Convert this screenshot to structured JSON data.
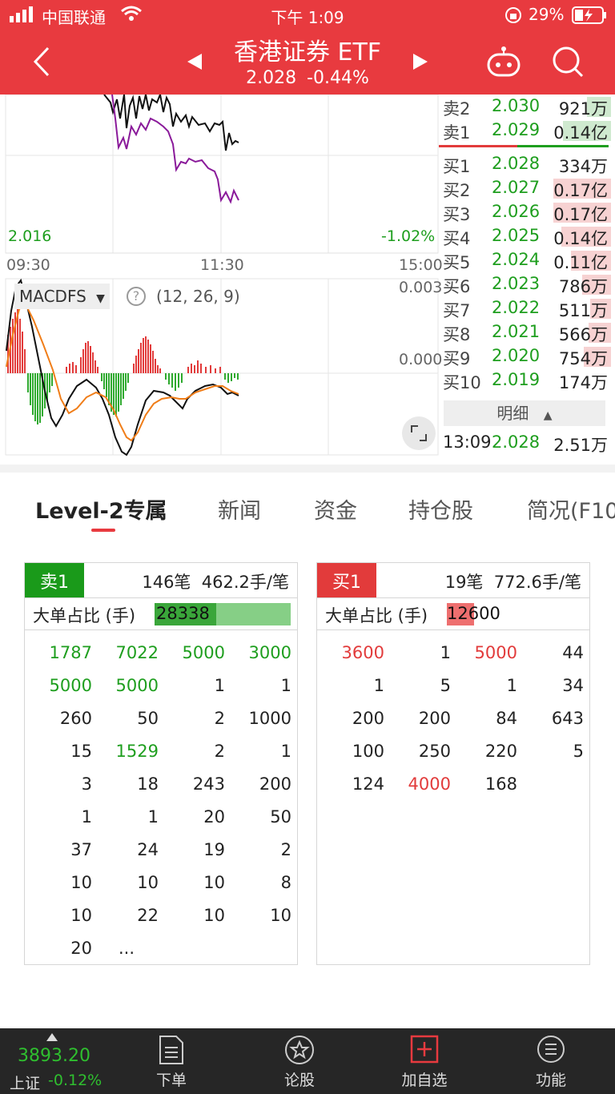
{
  "status_bar": {
    "carrier": "中国联通",
    "time": "下午 1:09",
    "battery": "29%"
  },
  "header": {
    "title": "香港证券 ETF",
    "price": "2.028",
    "change": "-0.44%"
  },
  "chart": {
    "price_low_label": "2.016",
    "pct_low_label": "-1.02%",
    "time_labels": [
      "09:30",
      "11:30",
      "15:00"
    ],
    "macd_top": "0.003",
    "macd_zero": "0.000",
    "indicator": "MACDFS",
    "indicator_params": "(12, 26, 9)"
  },
  "order_book": {
    "sell": [
      {
        "label": "卖2",
        "price": "2.030",
        "vol": "921万",
        "bar": 0.25
      },
      {
        "label": "卖1",
        "price": "2.029",
        "vol": "0.14亿",
        "bar": 0.32
      }
    ],
    "buy": [
      {
        "label": "买1",
        "price": "2.028",
        "vol": "334万",
        "bar": 0.0
      },
      {
        "label": "买2",
        "price": "2.027",
        "vol": "0.17亿",
        "bar": 0.7
      },
      {
        "label": "买3",
        "price": "2.026",
        "vol": "0.17亿",
        "bar": 0.7
      },
      {
        "label": "买4",
        "price": "2.025",
        "vol": "0.14亿",
        "bar": 0.6
      },
      {
        "label": "买5",
        "price": "2.024",
        "vol": "0.11亿",
        "bar": 0.45
      },
      {
        "label": "买6",
        "price": "2.023",
        "vol": "786万",
        "bar": 0.3
      },
      {
        "label": "买7",
        "price": "2.022",
        "vol": "511万",
        "bar": 0.2
      },
      {
        "label": "买8",
        "price": "2.021",
        "vol": "566万",
        "bar": 0.22
      },
      {
        "label": "买9",
        "price": "2.020",
        "vol": "754万",
        "bar": 0.28
      },
      {
        "label": "买10",
        "price": "2.019",
        "vol": "174万",
        "bar": 0.08
      }
    ],
    "detail_label": "明细",
    "last_trade": {
      "time": "13:09",
      "price": "2.028",
      "vol": "2.51万"
    }
  },
  "tabs": [
    "Level-2专属",
    "新闻",
    "资金",
    "持仓股",
    "简况(F10"
  ],
  "sell_panel": {
    "badge": "卖1",
    "count": "146笔",
    "avg": "462.2手/笔",
    "ratio_label": "大单占比 (手)",
    "ratio_value": "28338",
    "ratio_fill": 0.45,
    "rows": [
      [
        [
          "1787",
          "g"
        ],
        [
          "7022",
          "g"
        ],
        [
          "5000",
          "g"
        ],
        [
          "3000",
          "g"
        ]
      ],
      [
        [
          "5000",
          "g"
        ],
        [
          "5000",
          "g"
        ],
        [
          "1",
          ""
        ],
        [
          "1",
          ""
        ]
      ],
      [
        [
          "260",
          ""
        ],
        [
          "50",
          ""
        ],
        [
          "2",
          ""
        ],
        [
          "1000",
          ""
        ]
      ],
      [
        [
          "15",
          ""
        ],
        [
          "1529",
          "g"
        ],
        [
          "2",
          ""
        ],
        [
          "1",
          ""
        ]
      ],
      [
        [
          "3",
          ""
        ],
        [
          "18",
          ""
        ],
        [
          "243",
          ""
        ],
        [
          "200",
          ""
        ]
      ],
      [
        [
          "1",
          ""
        ],
        [
          "1",
          ""
        ],
        [
          "20",
          ""
        ],
        [
          "50",
          ""
        ]
      ],
      [
        [
          "37",
          ""
        ],
        [
          "24",
          ""
        ],
        [
          "19",
          ""
        ],
        [
          "2",
          ""
        ]
      ],
      [
        [
          "10",
          ""
        ],
        [
          "10",
          ""
        ],
        [
          "10",
          ""
        ],
        [
          "8",
          ""
        ]
      ],
      [
        [
          "10",
          ""
        ],
        [
          "22",
          ""
        ],
        [
          "10",
          ""
        ],
        [
          "10",
          ""
        ]
      ],
      [
        [
          "20",
          ""
        ],
        [
          "...",
          ""
        ]
      ]
    ]
  },
  "buy_panel": {
    "badge": "买1",
    "count": "19笔",
    "avg": "772.6手/笔",
    "ratio_label": "大单占比 (手)",
    "ratio_value": "12600",
    "ratio_fill": 0.2,
    "rows": [
      [
        [
          "3600",
          "r"
        ],
        [
          "1",
          ""
        ],
        [
          "5000",
          "r"
        ],
        [
          "44",
          ""
        ]
      ],
      [
        [
          "1",
          ""
        ],
        [
          "5",
          ""
        ],
        [
          "1",
          ""
        ],
        [
          "34",
          ""
        ]
      ],
      [
        [
          "200",
          ""
        ],
        [
          "200",
          ""
        ],
        [
          "84",
          ""
        ],
        [
          "643",
          ""
        ]
      ],
      [
        [
          "100",
          ""
        ],
        [
          "250",
          ""
        ],
        [
          "220",
          ""
        ],
        [
          "5",
          ""
        ]
      ],
      [
        [
          "124",
          ""
        ],
        [
          "4000",
          "r"
        ],
        [
          "168",
          ""
        ]
      ]
    ]
  },
  "bottom": {
    "index_value": "3893.20",
    "index_name": "上证",
    "index_change": "-0.12%",
    "nav": [
      "下单",
      "论股",
      "加自选",
      "功能"
    ]
  },
  "colors": {
    "brand_red": "#e83a3f",
    "up_red": "#e23b3b",
    "down_green": "#1e9e1e",
    "macd_line_orange": "#f07d18",
    "avg_line_purple": "#8a1a9a"
  }
}
